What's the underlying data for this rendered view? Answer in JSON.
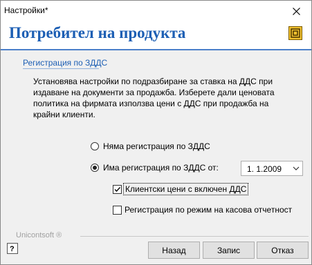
{
  "window": {
    "title": "Настройки*"
  },
  "header": {
    "title": "Потребител на продукта",
    "icon": "uni-logo-icon"
  },
  "section": {
    "label": "Регистрация по ЗДДС",
    "description": "Установява настройки по подразбиране за ставка на ДДС при издаване на документи за продажба. Изберете дали ценовата политика на фирмата използва цени с ДДС при продажба на крайни клиенти."
  },
  "options": {
    "no_registration": {
      "label": "Няма регистрация по ЗДДС",
      "selected": false
    },
    "has_registration": {
      "label": "Има регистрация по ЗДДС от:",
      "selected": true
    },
    "registration_date": "1.  1.2009",
    "vat_included_prices": {
      "label": "Клиентски цени с включен ДДС",
      "checked": true
    },
    "cash_accounting": {
      "label": "Регистрация по режим на касова отчетност",
      "checked": false
    }
  },
  "footer": {
    "brand": "Unicontsoft ®",
    "back_label": "Назад",
    "save_label": "Запис",
    "cancel_label": "Отказ"
  },
  "colors": {
    "accent": "#1d5fb4",
    "rule": "#4b7fc9"
  }
}
